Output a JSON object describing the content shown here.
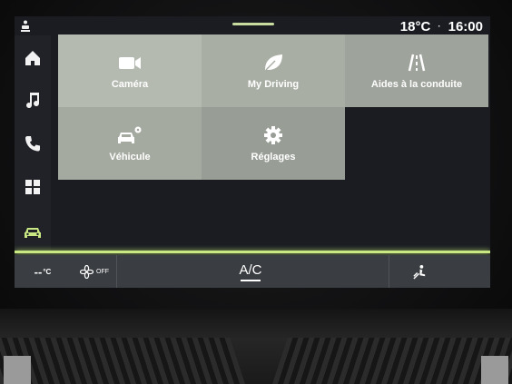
{
  "status_bar": {
    "left_icon": "seat-icon",
    "temperature": "18°C",
    "time": "16:00",
    "separator": "·"
  },
  "sidebar": {
    "items": [
      {
        "name": "home",
        "icon": "home-icon",
        "active": false
      },
      {
        "name": "music",
        "icon": "music-note-icon",
        "active": false
      },
      {
        "name": "phone",
        "icon": "phone-icon",
        "active": false
      },
      {
        "name": "apps",
        "icon": "apps-grid-icon",
        "active": false
      },
      {
        "name": "vehicle",
        "icon": "car-icon",
        "active": true
      }
    ]
  },
  "tiles": [
    {
      "label": "Caméra",
      "icon": "camera-icon"
    },
    {
      "label": "My Driving",
      "icon": "leaf-icon"
    },
    {
      "label": "Aides à la conduite",
      "icon": "lane-assist-icon"
    },
    {
      "label": "Véhicule",
      "icon": "car-settings-icon"
    },
    {
      "label": "Réglages",
      "icon": "gear-icon"
    }
  ],
  "climate": {
    "left_temp": "--",
    "left_temp_unit": "°C",
    "fan_label": "OFF",
    "ac_label": "A/C",
    "air_icon": "air-distribution-icon"
  },
  "colors": {
    "accent": "#c9e884",
    "tile_light": "#b4bab0",
    "tile_dark": "#9ea49c",
    "active_icon": "#c9e884"
  }
}
